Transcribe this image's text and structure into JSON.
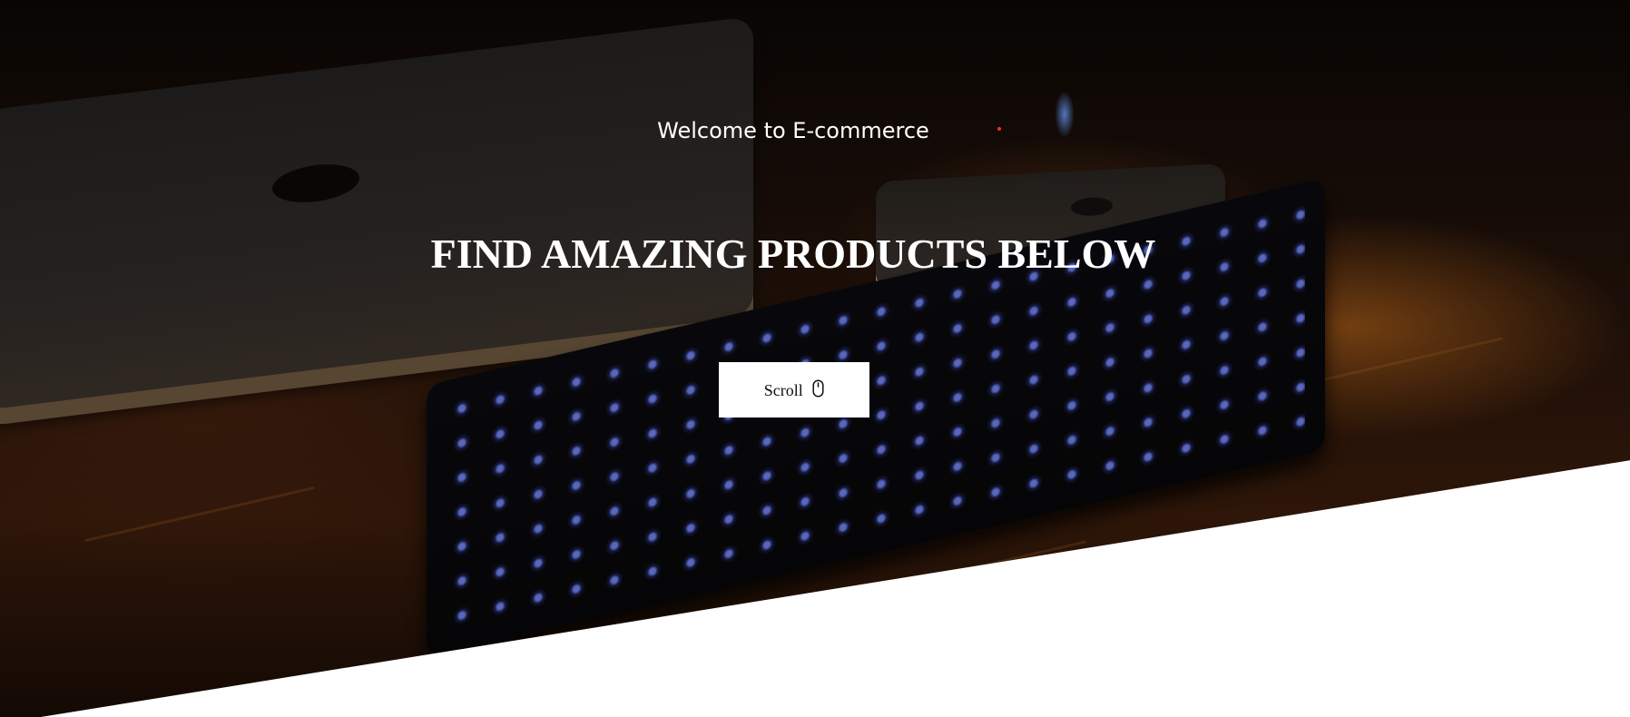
{
  "hero": {
    "welcome_text": "Welcome to E-commerce",
    "headline": "FIND AMAZING PRODUCTS BELOW",
    "scroll_label": "Scroll",
    "scroll_icon": "mouse-icon",
    "colors": {
      "page_background": "#ffffff",
      "headline": "#ffffff",
      "button_background": "#ffffff",
      "accent_dot": "#ff2a2a"
    }
  }
}
